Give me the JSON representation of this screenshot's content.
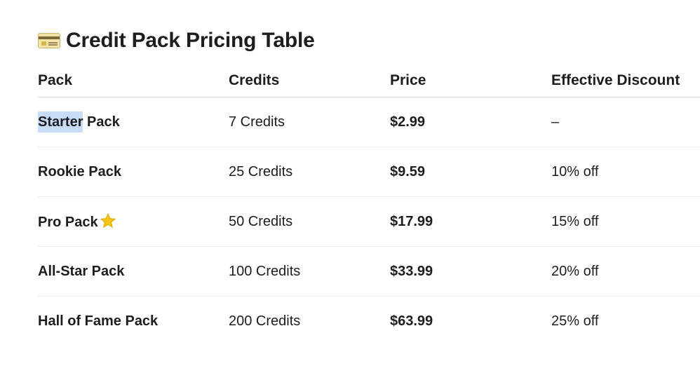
{
  "document": {
    "title": "Credit Pack Pricing Table",
    "title_icon": "credit-card-icon"
  },
  "table": {
    "headers": [
      "Pack",
      "Credits",
      "Price",
      "Effective Discount"
    ],
    "rows": [
      {
        "pack_first_word": "Starter",
        "pack_rest": " Pack",
        "credits": "7 Credits",
        "price": "$2.99",
        "discount": "–"
      },
      {
        "pack": "Rookie Pack",
        "credits": "25 Credits",
        "price": "$9.59",
        "discount": "10% off"
      },
      {
        "pack": "Pro Pack",
        "pack_icon": "star-icon",
        "credits": "50 Credits",
        "price": "$17.99",
        "discount": "15% off"
      },
      {
        "pack": "All-Star Pack",
        "credits": "100 Credits",
        "price": "$33.99",
        "discount": "20% off"
      },
      {
        "pack": "Hall of Fame Pack",
        "credits": "200 Credits",
        "price": "$63.99",
        "discount": "25% off"
      }
    ]
  },
  "colors": {
    "text": "#1d1d1f",
    "selection_highlight": "#c6dcf7",
    "star": "#f5c518"
  }
}
